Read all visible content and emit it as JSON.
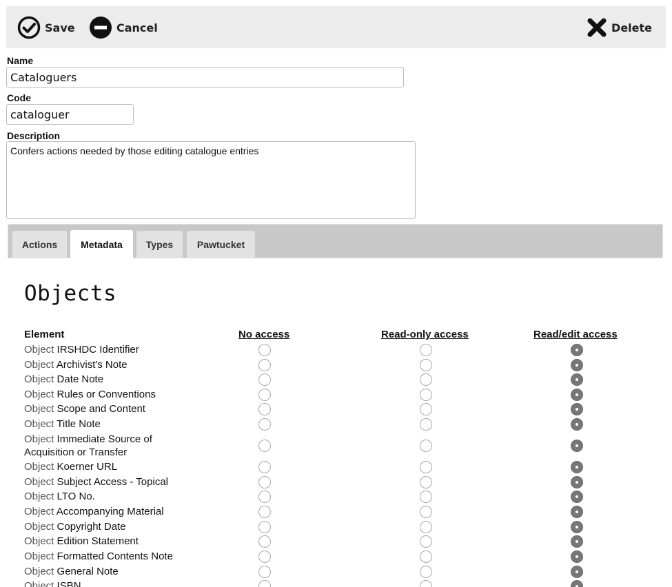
{
  "toolbar": {
    "save_label": "Save",
    "cancel_label": "Cancel",
    "delete_label": "Delete"
  },
  "form": {
    "name_label": "Name",
    "name_value": "Cataloguers",
    "code_label": "Code",
    "code_value": "cataloguer",
    "description_label": "Description",
    "description_value": "Confers actions needed by those editing catalogue entries"
  },
  "tabs": [
    {
      "label": "Actions",
      "active": false
    },
    {
      "label": "Metadata",
      "active": true
    },
    {
      "label": "Types",
      "active": false
    },
    {
      "label": "Pawtucket",
      "active": false
    }
  ],
  "section": {
    "title": "Objects"
  },
  "table": {
    "headers": {
      "element": "Element",
      "no_access": "No access",
      "read_only": "Read-only access",
      "read_edit": "Read/edit access"
    },
    "rows": [
      {
        "prefix": "Object",
        "name": "IRSHDC Identifier",
        "access": "read_edit"
      },
      {
        "prefix": "Object",
        "name": "Archivist's Note",
        "access": "read_edit"
      },
      {
        "prefix": "Object",
        "name": "Date Note",
        "access": "read_edit"
      },
      {
        "prefix": "Object",
        "name": "Rules or Conventions",
        "access": "read_edit"
      },
      {
        "prefix": "Object",
        "name": "Scope and Content",
        "access": "read_edit"
      },
      {
        "prefix": "Object",
        "name": "Title Note",
        "access": "read_edit"
      },
      {
        "prefix": "Object",
        "name": "Immediate Source of Acquisition or Transfer",
        "access": "read_edit"
      },
      {
        "prefix": "Object",
        "name": "Koerner URL",
        "access": "read_edit"
      },
      {
        "prefix": "Object",
        "name": "Subject Access - Topical",
        "access": "read_edit"
      },
      {
        "prefix": "Object",
        "name": "LTO No.",
        "access": "read_edit"
      },
      {
        "prefix": "Object",
        "name": "Accompanying Material",
        "access": "read_edit"
      },
      {
        "prefix": "Object",
        "name": "Copyright Date",
        "access": "read_edit"
      },
      {
        "prefix": "Object",
        "name": "Edition Statement",
        "access": "read_edit"
      },
      {
        "prefix": "Object",
        "name": "Formatted Contents Note",
        "access": "read_edit"
      },
      {
        "prefix": "Object",
        "name": "General Note",
        "access": "read_edit"
      },
      {
        "prefix": "Object",
        "name": "ISBN",
        "access": "read_edit"
      }
    ]
  },
  "colors": {
    "toolbar_bg": "#ececec",
    "tabbar_bg": "#c8c8c8",
    "radio_selected": "#777777"
  }
}
